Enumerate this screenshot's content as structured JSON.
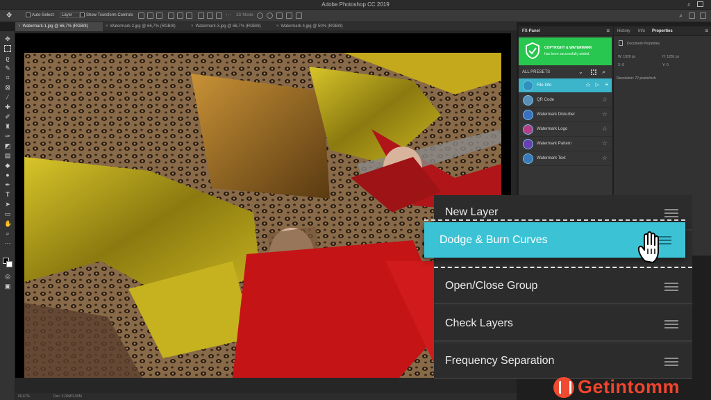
{
  "app": {
    "title": "Adobe Photoshop CC 2019"
  },
  "options": {
    "auto_select": "Auto-Select:",
    "layer_value": "Layer",
    "show_transform": "Show Transform Controls",
    "mode_3d": "3D Mode:"
  },
  "tabs": [
    {
      "label": "Watermark-1.jpg @ 66,7% (RGB/8)"
    },
    {
      "label": "Watermark-2.jpg @ 66,7% (RGB/8)"
    },
    {
      "label": "Watermark-3.jpg @ 66,7% (RGB/8)"
    },
    {
      "label": "Watermark-4.jpg @ 50% (RGB/8)"
    }
  ],
  "status": {
    "zoom": "66,67%",
    "doc": "Doc: 3,00M/3,00M"
  },
  "fx": {
    "title": "FX-Panel",
    "notice_title": "COPYRIGHT & WATERMARK",
    "notice_text": "has been successfully added.",
    "presets_label": "ALL PRESETS",
    "presets": [
      {
        "label": "File Info",
        "icon": "file-info-icon"
      },
      {
        "label": "QR Code",
        "icon": "qr-code-icon"
      },
      {
        "label": "Watermark Disturber",
        "icon": "disturber-icon"
      },
      {
        "label": "Watermark Logo",
        "icon": "logo-icon"
      },
      {
        "label": "Watermark Pattern",
        "icon": "pattern-icon"
      },
      {
        "label": "Watermark Text",
        "icon": "text-icon"
      }
    ]
  },
  "right_panel": {
    "tabs": [
      "History",
      "Info",
      "Properties"
    ],
    "doc_props": "Document Properties",
    "w": "W: 1920 px",
    "h": "H: 1281 px",
    "x": "X: 0",
    "y": "Y: 0",
    "resolution": "Resolution: 72 pixels/inch"
  },
  "menu": {
    "items": [
      "New Layer",
      "Open/Close Group",
      "Check Layers",
      "Frequency Separation"
    ],
    "dragging": "Dodge & Burn Curves"
  },
  "brand": {
    "name": "Getintomm"
  },
  "colors": {
    "accent": "#3bc3d5",
    "notice": "#28c74f",
    "brand": "#f0452e"
  }
}
